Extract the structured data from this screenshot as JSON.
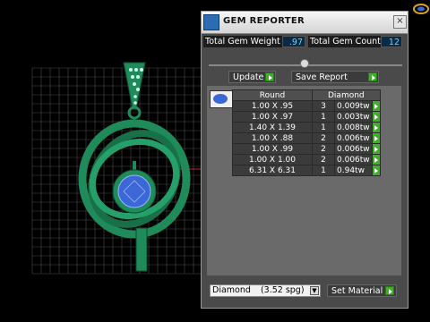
{
  "window": {
    "title": "GEM REPORTER"
  },
  "stats": {
    "total_weight_label": "Total Gem Weight",
    "total_weight_value": ".97",
    "total_count_label": "Total Gem Count",
    "total_count_value": "12"
  },
  "buttons": {
    "update": "Update",
    "save_report": "Save Report",
    "set_material": "Set Material"
  },
  "table": {
    "headers": {
      "shape": "Round",
      "material": "Diamond"
    },
    "rows": [
      {
        "size": "1.00 X .95",
        "count": "3",
        "weight": "0.009tw"
      },
      {
        "size": "1.00 X .97",
        "count": "1",
        "weight": "0.003tw"
      },
      {
        "size": "1.40 X 1.39",
        "count": "1",
        "weight": "0.008tw"
      },
      {
        "size": "1.00 X .88",
        "count": "2",
        "weight": "0.006tw"
      },
      {
        "size": "1.00 X .99",
        "count": "2",
        "weight": "0.006tw"
      },
      {
        "size": "1.00 X 1.00",
        "count": "2",
        "weight": "0.006tw"
      },
      {
        "size": "6.31 X 6.31",
        "count": "1",
        "weight": "0.94tw"
      }
    ]
  },
  "material_select": {
    "value": "Diamond",
    "spg": "(3.52 spg)"
  },
  "colors": {
    "accent_green": "#3fae2a",
    "metal_green": "#1f8a5a",
    "gem_blue": "#3c67d6"
  }
}
